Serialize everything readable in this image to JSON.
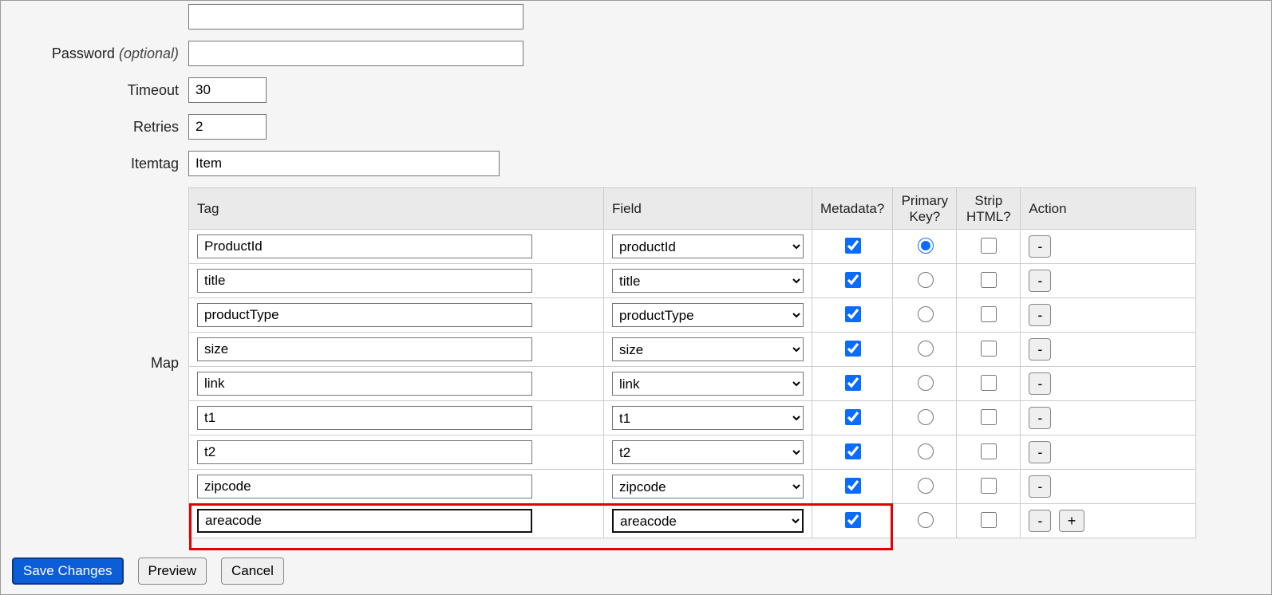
{
  "form": {
    "password_label": "Password",
    "password_optional": "(optional)",
    "password_value": "",
    "timeout_label": "Timeout",
    "timeout_value": "30",
    "retries_label": "Retries",
    "retries_value": "2",
    "itemtag_label": "Itemtag",
    "itemtag_value": "Item",
    "map_label": "Map"
  },
  "table": {
    "headers": {
      "tag": "Tag",
      "field": "Field",
      "metadata": "Metadata?",
      "primary_key": "Primary Key?",
      "strip_html": "Strip HTML?",
      "action": "Action"
    },
    "rows": [
      {
        "tag": "ProductId",
        "field": "productId",
        "metadata": true,
        "primary_key": true,
        "strip_html": false,
        "action_remove": "-",
        "highlight": false
      },
      {
        "tag": "title",
        "field": "title",
        "metadata": true,
        "primary_key": false,
        "strip_html": false,
        "action_remove": "-",
        "highlight": false
      },
      {
        "tag": "productType",
        "field": "productType",
        "metadata": true,
        "primary_key": false,
        "strip_html": false,
        "action_remove": "-",
        "highlight": false
      },
      {
        "tag": "size",
        "field": "size",
        "metadata": true,
        "primary_key": false,
        "strip_html": false,
        "action_remove": "-",
        "highlight": false
      },
      {
        "tag": "link",
        "field": "link",
        "metadata": true,
        "primary_key": false,
        "strip_html": false,
        "action_remove": "-",
        "highlight": false
      },
      {
        "tag": "t1",
        "field": "t1",
        "metadata": true,
        "primary_key": false,
        "strip_html": false,
        "action_remove": "-",
        "highlight": false
      },
      {
        "tag": "t2",
        "field": "t2",
        "metadata": true,
        "primary_key": false,
        "strip_html": false,
        "action_remove": "-",
        "highlight": false
      },
      {
        "tag": "zipcode",
        "field": "zipcode",
        "metadata": true,
        "primary_key": false,
        "strip_html": false,
        "action_remove": "-",
        "highlight": false
      },
      {
        "tag": "areacode",
        "field": "areacode",
        "metadata": true,
        "primary_key": false,
        "strip_html": false,
        "action_remove": "-",
        "action_add": "+",
        "highlight": true
      }
    ]
  },
  "footer": {
    "save": "Save Changes",
    "preview": "Preview",
    "cancel": "Cancel"
  }
}
